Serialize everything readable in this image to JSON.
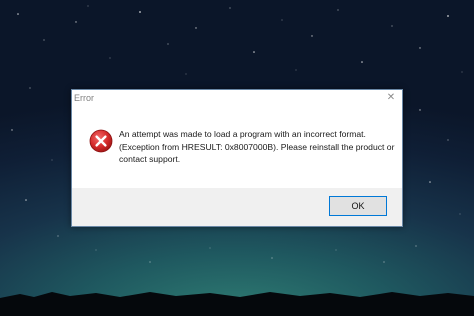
{
  "dialog": {
    "title": "Error",
    "close_glyph": "✕",
    "icon": "error-icon",
    "message": "An attempt was made to load a program with an incorrect format. (Exception from HRESULT: 0x8007000B). Please reinstall the product or contact support.",
    "ok_label": "OK"
  },
  "colors": {
    "error_red": "#d42a2a",
    "button_border": "#0078d7",
    "footer_bg": "#f0f0f0"
  }
}
